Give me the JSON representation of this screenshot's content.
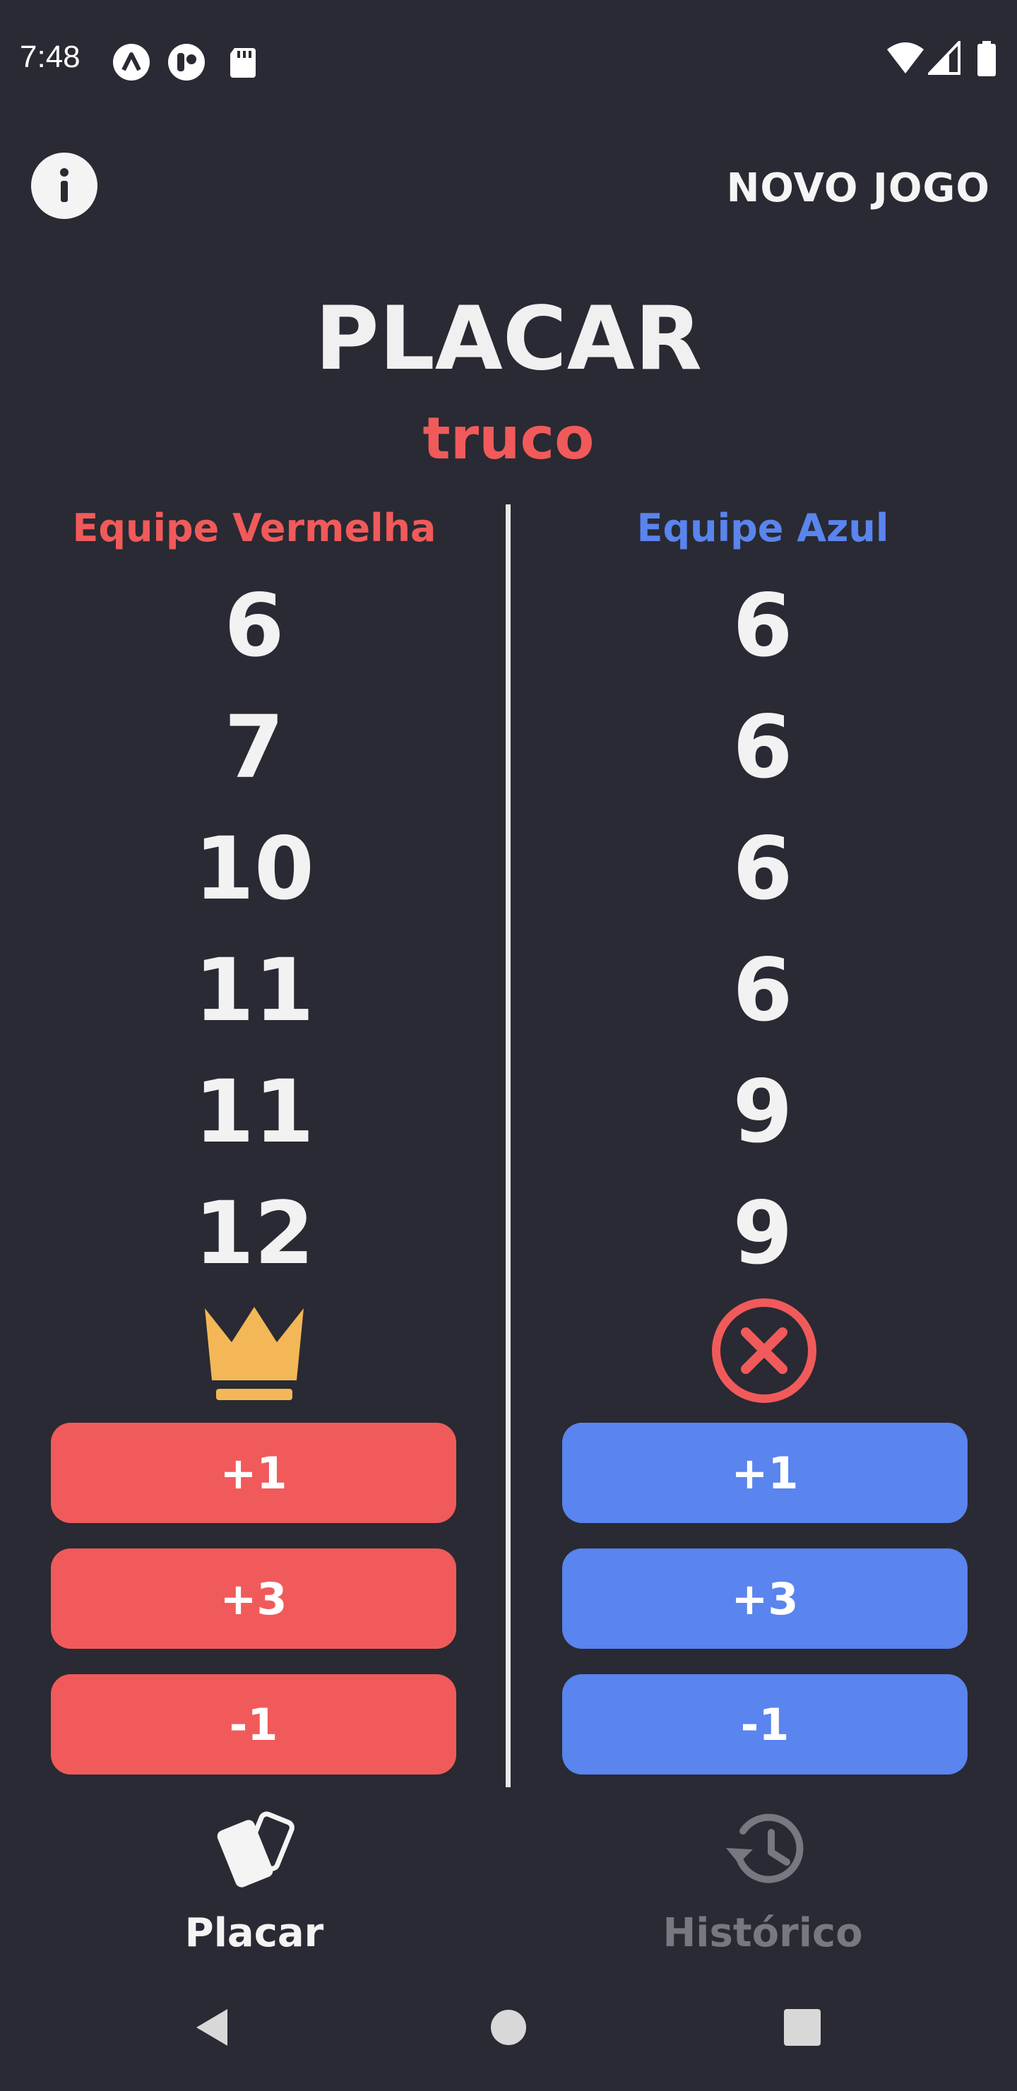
{
  "status_bar": {
    "time": "7:48",
    "icons_left": [
      "notification-a-icon",
      "notification-circle-icon",
      "sd-card-icon"
    ],
    "icons_right": [
      "wifi-icon",
      "signal-icon",
      "battery-icon"
    ]
  },
  "header": {
    "info_icon": "info-icon",
    "new_game_label": "NOVO JOGO"
  },
  "title": "PLACAR",
  "subtitle": "truco",
  "teams": [
    {
      "name": "Equipe Vermelha",
      "color": "#f15a5a",
      "scores": [
        "6",
        "7",
        "10",
        "11",
        "11",
        "12"
      ],
      "status_icon": "crown-icon",
      "buttons": [
        "+1",
        "+3",
        "-1"
      ]
    },
    {
      "name": "Equipe Azul",
      "color": "#5a84ee",
      "scores": [
        "6",
        "6",
        "6",
        "6",
        "9",
        "9"
      ],
      "status_icon": "cancel-circle-icon",
      "buttons": [
        "+1",
        "+3",
        "-1"
      ]
    }
  ],
  "bottom_nav": [
    {
      "label": "Placar",
      "icon": "cards-icon",
      "active": true
    },
    {
      "label": "Histórico",
      "icon": "history-icon",
      "active": false
    }
  ],
  "system_nav": [
    "back-icon",
    "home-icon",
    "recents-icon"
  ],
  "colors": {
    "background": "#292a33",
    "red": "#f15a5a",
    "blue": "#5a84ee",
    "crown": "#f3b757"
  }
}
